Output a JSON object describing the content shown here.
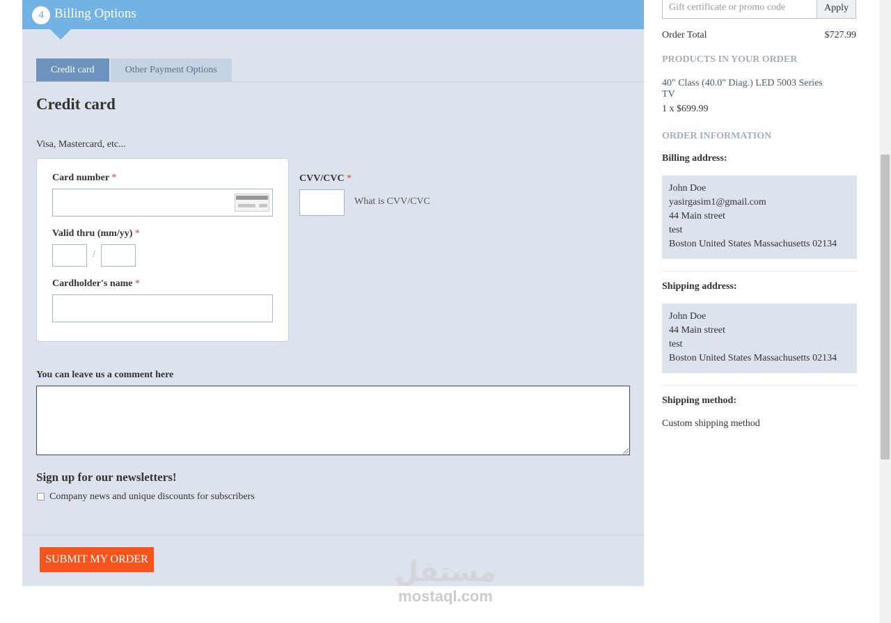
{
  "billing": {
    "step_number": "4",
    "title": "Billing Options",
    "tabs": [
      {
        "label": "Credit card",
        "active": true
      },
      {
        "label": "Other Payment Options",
        "active": false
      }
    ],
    "heading": "Credit card",
    "subtitle": "Visa, Mastercard, etc...",
    "card_number_label": "Card number",
    "valid_thru_label": "Valid thru (mm/yy)",
    "date_separator": "/",
    "cardholder_label": "Cardholder's name",
    "cvv_label": "CVV/CVC",
    "cvv_help": "What is CVV/CVC",
    "required_mark": "*",
    "comment_label": "You can leave us a comment here",
    "newsletter_heading": "Sign up for our newsletters!",
    "newsletter_option": "Company news and unique discounts for subscribers",
    "submit_label": "SUBMIT MY ORDER"
  },
  "watermark": {
    "arabic": "مستقل",
    "latin": "mostaql.com"
  },
  "sidebar": {
    "promo_placeholder": "Gift certificate or promo code",
    "apply_label": "Apply",
    "order_total_label": "Order Total",
    "order_total_value": "$727.99",
    "products_heading": "PRODUCTS IN YOUR ORDER",
    "product_name": "40\" Class (40.0\" Diag.) LED 5003 Series TV",
    "product_qty": "1 x $699.99",
    "order_info_heading": "ORDER INFORMATION",
    "billing_address_label": "Billing address:",
    "billing_address": {
      "name": "John Doe",
      "email": "yasirgasim1@gmail.com",
      "street": "44 Main street",
      "line2": "test",
      "city": "Boston United States Massachusetts 02134"
    },
    "shipping_address_label": "Shipping address:",
    "shipping_address": {
      "name": "John Doe",
      "street": "44 Main street",
      "line2": "test",
      "city": "Boston United States Massachusetts 02134"
    },
    "shipping_method_label": "Shipping method:",
    "shipping_method": "Custom shipping method"
  },
  "colors": {
    "header_blue": "#73b3e4",
    "panel_bg": "#dde3ec",
    "tab_active": "#6b93bd",
    "submit_orange": "#f5551d",
    "required_red": "#e03a3a"
  }
}
